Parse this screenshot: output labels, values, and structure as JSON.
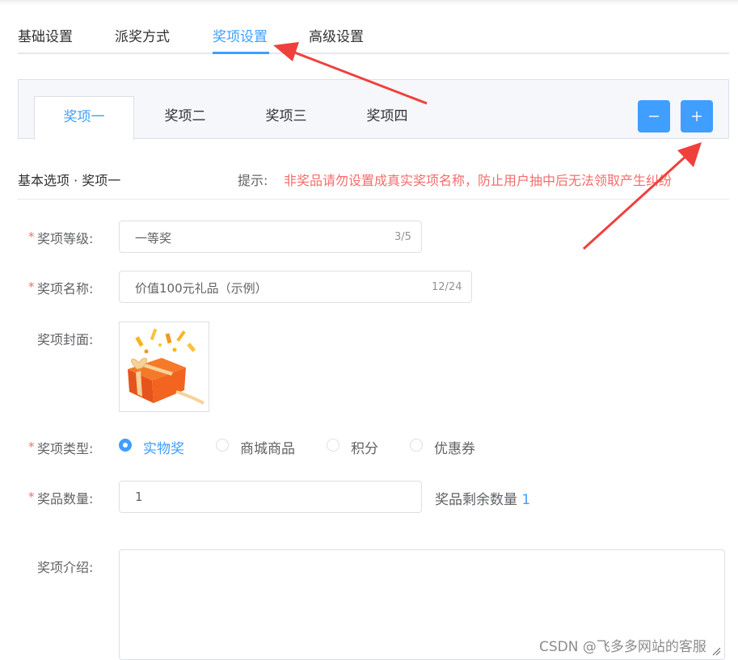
{
  "main_tabs": [
    {
      "label": "基础设置",
      "active": false
    },
    {
      "label": "派奖方式",
      "active": false
    },
    {
      "label": "奖项设置",
      "active": true
    },
    {
      "label": "高级设置",
      "active": false
    }
  ],
  "prize_tabs": [
    {
      "label": "奖项一",
      "active": true
    },
    {
      "label": "奖项二",
      "active": false
    },
    {
      "label": "奖项三",
      "active": false
    },
    {
      "label": "奖项四",
      "active": false
    }
  ],
  "controls": {
    "remove_icon": "minus-icon",
    "add_icon": "plus-icon"
  },
  "section": {
    "title": "基本选项 · 奖项一",
    "hint_label": "提示:",
    "hint_text": "非奖品请勿设置成真实奖项名称，防止用户抽中后无法领取产生纠纷"
  },
  "form": {
    "required_mark": "*",
    "level": {
      "label": "奖项等级:",
      "value": "一等奖",
      "counter": "3/5"
    },
    "name": {
      "label": "奖项名称:",
      "value": "价值100元礼品（示例）",
      "counter": "12/24"
    },
    "cover": {
      "label": "奖项封面:",
      "image": "gift-box-image"
    },
    "type": {
      "label": "奖项类型:",
      "options": [
        {
          "label": "实物奖",
          "checked": true
        },
        {
          "label": "商城商品",
          "checked": false
        },
        {
          "label": "积分",
          "checked": false
        },
        {
          "label": "优惠券",
          "checked": false
        }
      ]
    },
    "quantity": {
      "label": "奖品数量:",
      "value": "1",
      "remain_label": "奖品剩余数量",
      "remain_value": "1"
    },
    "intro": {
      "label": "奖项介绍:",
      "value": ""
    }
  },
  "watermark": "CSDN @飞多多网站的客服",
  "colors": {
    "accent": "#409eff",
    "danger": "#f56c6c",
    "annotation": "#f0403c"
  }
}
